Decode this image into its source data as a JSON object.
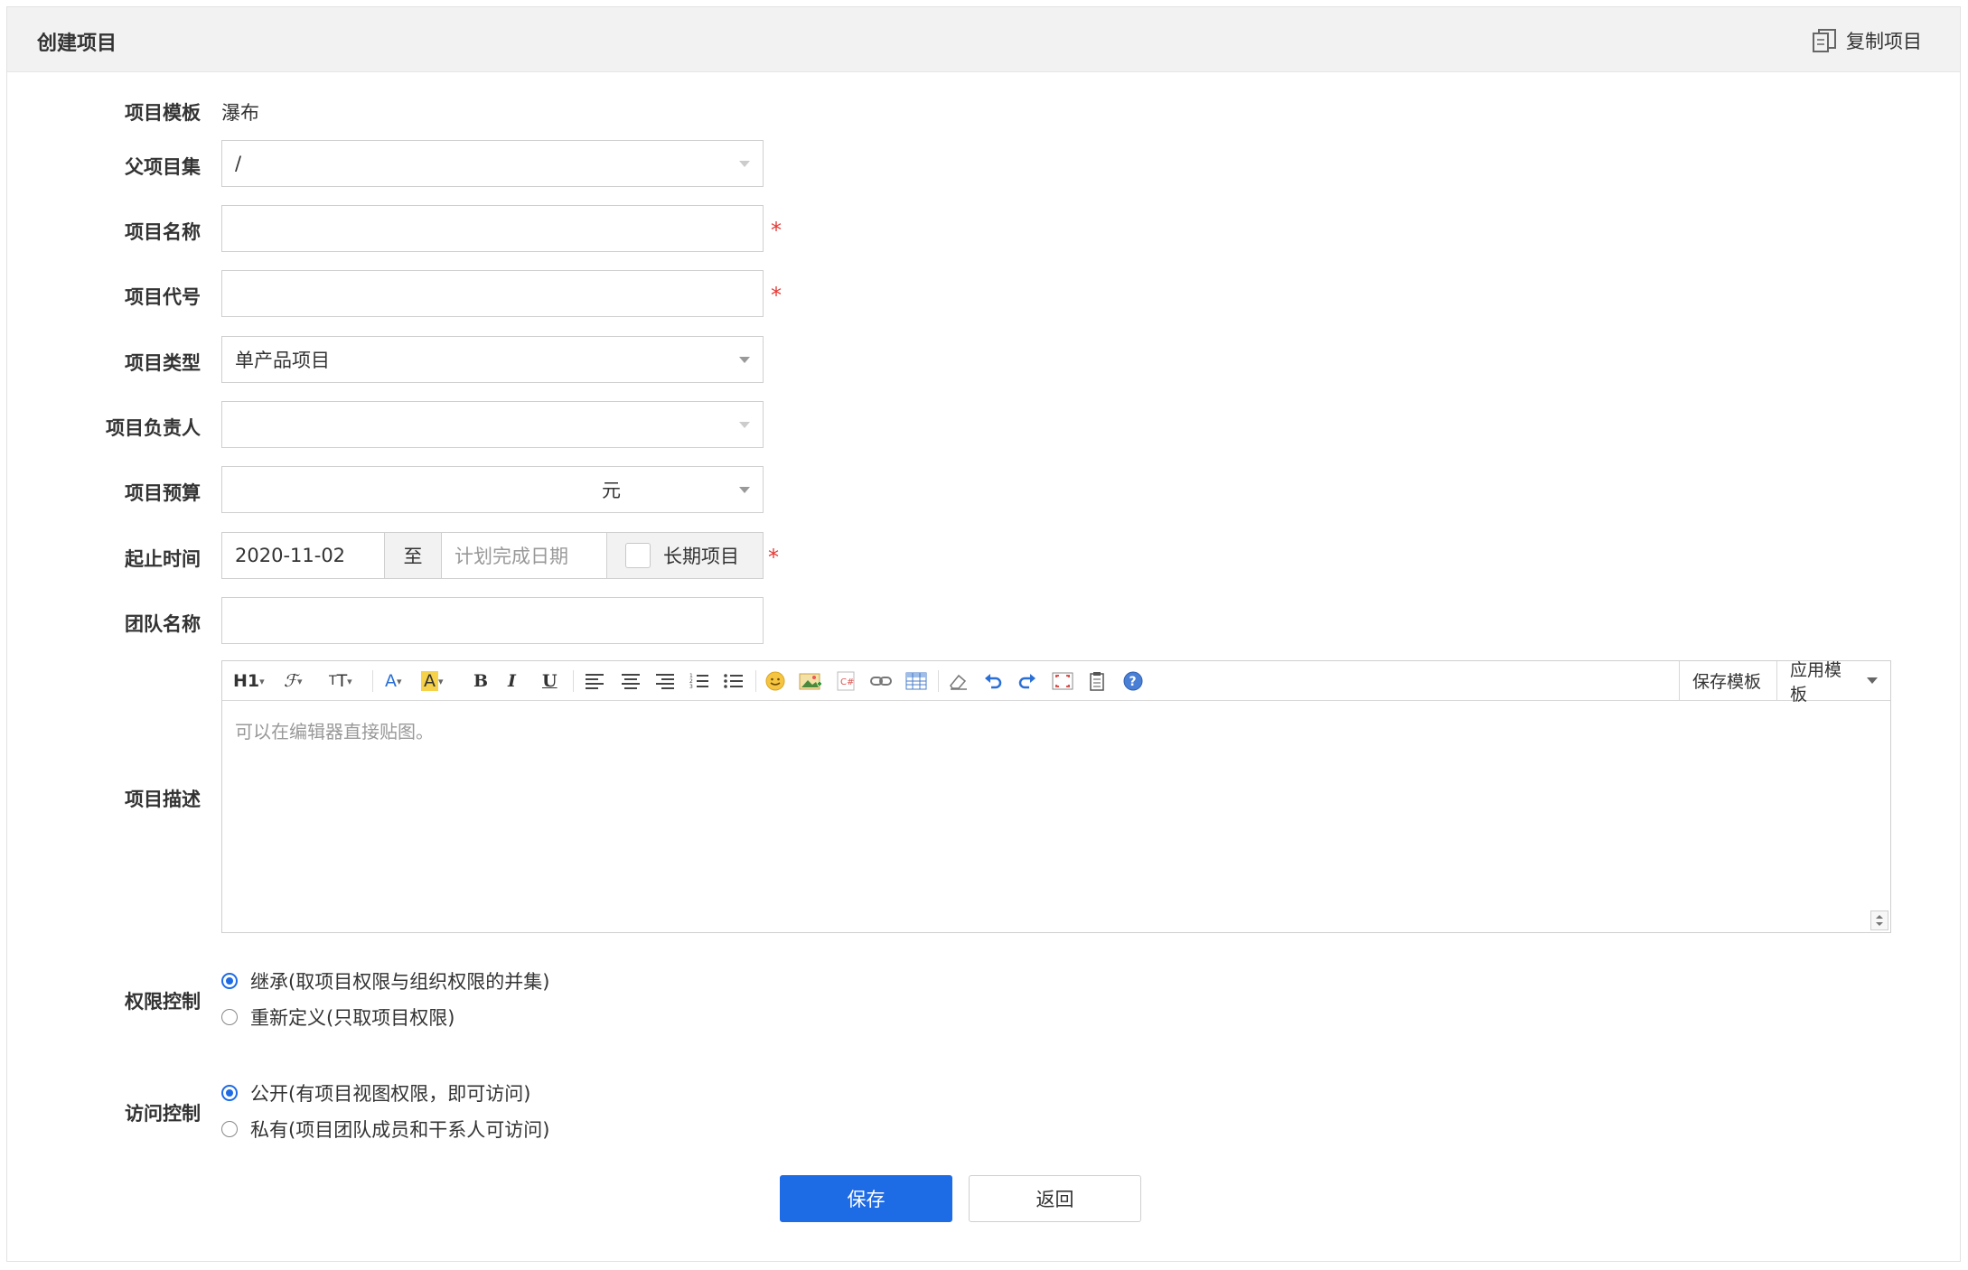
{
  "header": {
    "title": "创建项目",
    "copy_label": "复制项目"
  },
  "form": {
    "template": {
      "label": "项目模板",
      "value": "瀑布"
    },
    "parent_set": {
      "label": "父项目集",
      "value": "/"
    },
    "project_name": {
      "label": "项目名称",
      "value": "",
      "required_mark": "*"
    },
    "project_code": {
      "label": "项目代号",
      "value": "",
      "required_mark": "*"
    },
    "project_type": {
      "label": "项目类型",
      "value": "单产品项目"
    },
    "owner": {
      "label": "项目负责人",
      "value": ""
    },
    "budget": {
      "label": "项目预算",
      "value": "",
      "unit": "元"
    },
    "dates": {
      "label": "起止时间",
      "start": "2020-11-02",
      "separator": "至",
      "end_placeholder": "计划完成日期",
      "long_term_label": "长期项目",
      "required_mark": "*"
    },
    "team": {
      "label": "团队名称",
      "value": ""
    },
    "description": {
      "label": "项目描述",
      "placeholder": "可以在编辑器直接贴图。",
      "toolbar": {
        "save_template": "保存模板",
        "apply_template": "应用模板"
      }
    },
    "permission": {
      "label": "权限控制",
      "options": [
        {
          "label": "继承(取项目权限与组织权限的并集)",
          "checked": true
        },
        {
          "label": "重新定义(只取项目权限)",
          "checked": false
        }
      ]
    },
    "access": {
      "label": "访问控制",
      "options": [
        {
          "label": "公开(有项目视图权限，即可访问)",
          "checked": true
        },
        {
          "label": "私有(项目团队成员和干系人可访问)",
          "checked": false
        }
      ]
    }
  },
  "actions": {
    "save": "保存",
    "back": "返回"
  },
  "colors": {
    "primary": "#1e6be6",
    "required": "#e53935",
    "header_bg": "#f2f2f2"
  }
}
